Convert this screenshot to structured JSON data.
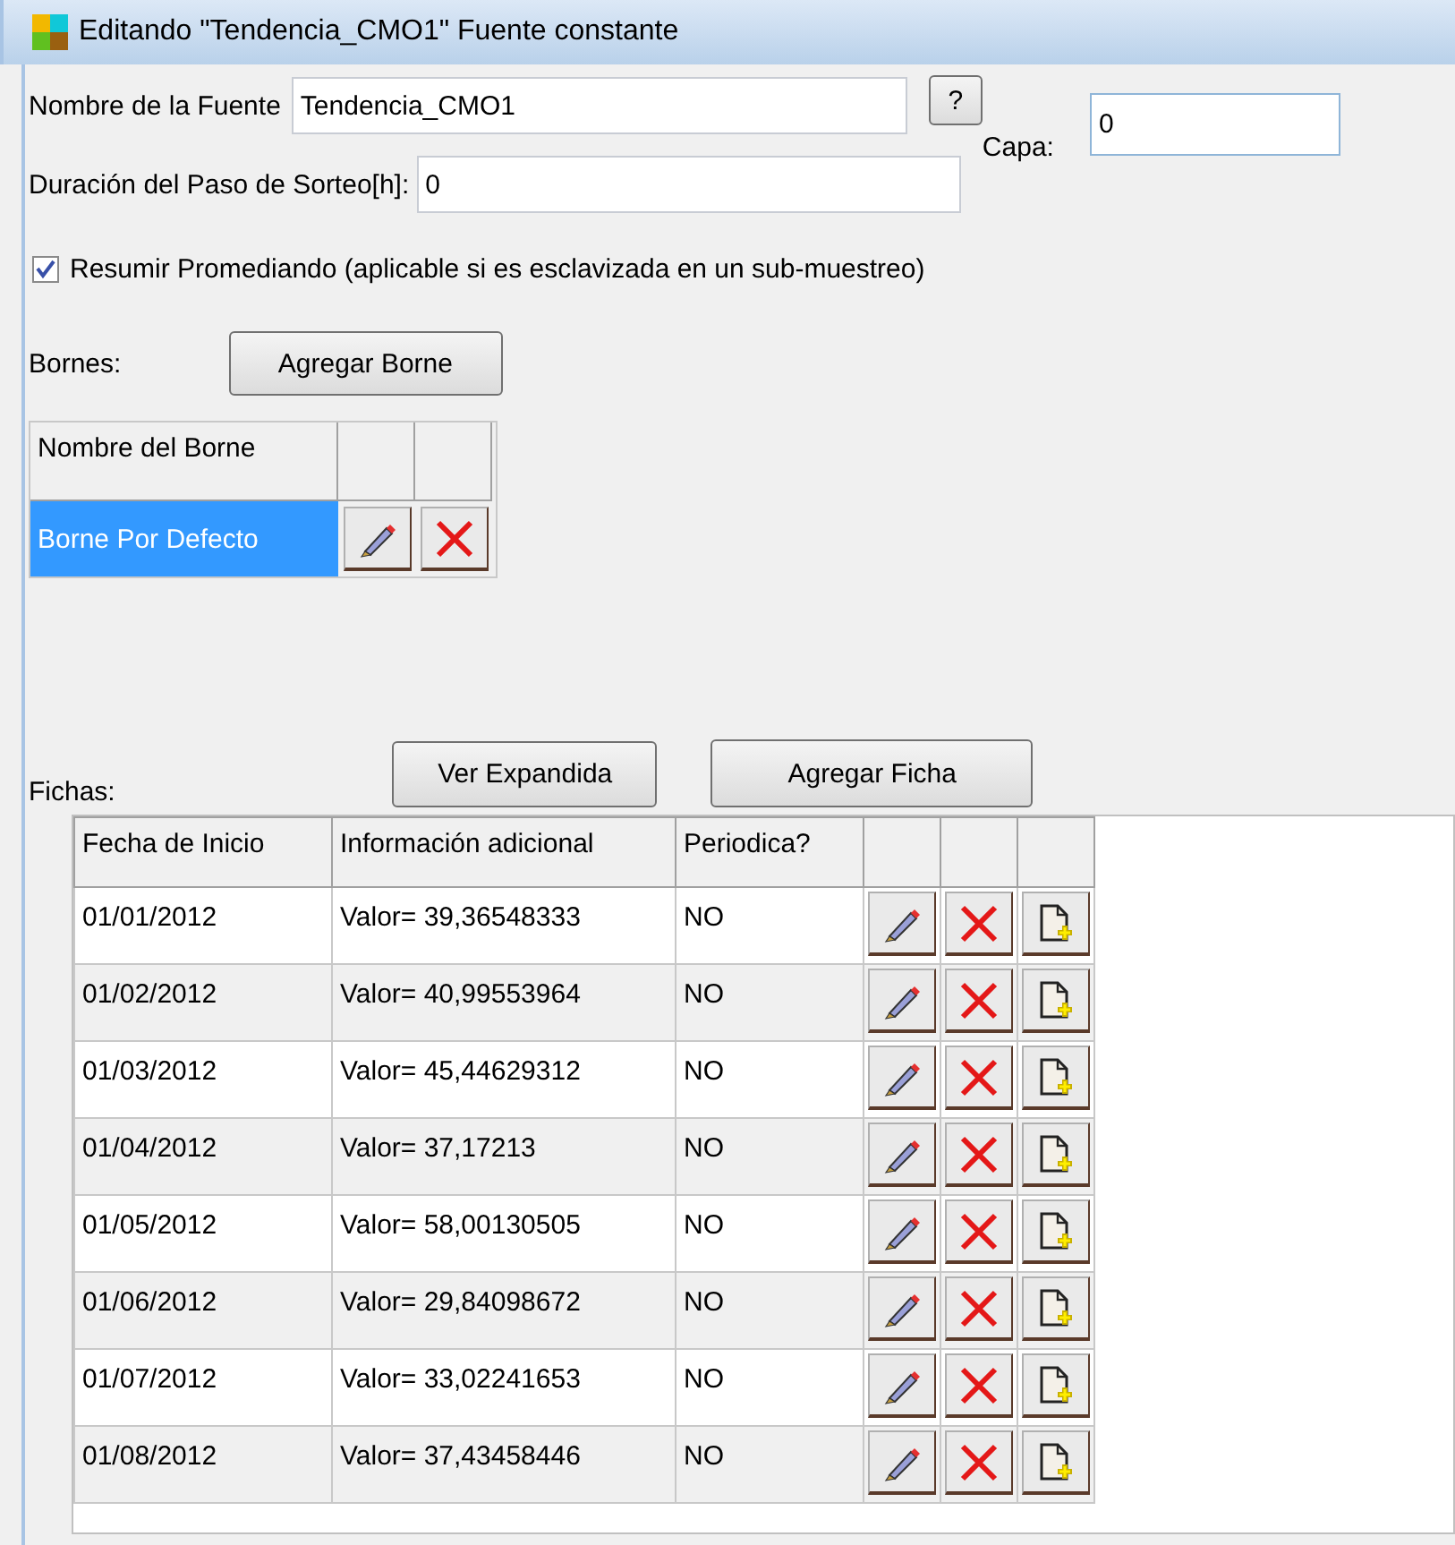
{
  "window": {
    "title": "Editando \"Tendencia_CMO1\" Fuente constante"
  },
  "source_name": {
    "label": "Nombre de la Fuente",
    "value": "Tendencia_CMO1",
    "help_button": "?"
  },
  "layer": {
    "label": "Capa:",
    "value": "0"
  },
  "step_duration": {
    "label": "Duración del Paso de Sorteo[h]:",
    "value": "0"
  },
  "summarize": {
    "label": "Resumir Promediando (aplicable si es esclavizada en un sub-muestreo)",
    "checked": true
  },
  "terminals": {
    "label": "Bornes:",
    "add_button": "Agregar Borne",
    "columns": [
      "Nombre del Borne"
    ],
    "rows": [
      {
        "name": "Borne Por Defecto",
        "selected": true
      }
    ]
  },
  "records": {
    "label": "Fichas:",
    "expand_button": "Ver Expandida",
    "add_button": "Agregar Ficha",
    "columns": [
      "Fecha de Inicio",
      "Información adicional",
      "Periodica?"
    ],
    "rows": [
      {
        "cells": [
          "01/01/2012",
          "Valor= 39,36548333",
          "NO"
        ]
      },
      {
        "cells": [
          "01/02/2012",
          "Valor= 40,99553964",
          "NO"
        ]
      },
      {
        "cells": [
          "01/03/2012",
          "Valor= 45,44629312",
          "NO"
        ]
      },
      {
        "cells": [
          "01/04/2012",
          "Valor= 37,17213",
          "NO"
        ]
      },
      {
        "cells": [
          "01/05/2012",
          "Valor= 58,00130505",
          "NO"
        ]
      },
      {
        "cells": [
          "01/06/2012",
          "Valor= 29,84098672",
          "NO"
        ]
      },
      {
        "cells": [
          "01/07/2012",
          "Valor= 33,02241653",
          "NO"
        ]
      },
      {
        "cells": [
          "01/08/2012",
          "Valor= 37,43458446",
          "NO"
        ]
      }
    ]
  }
}
